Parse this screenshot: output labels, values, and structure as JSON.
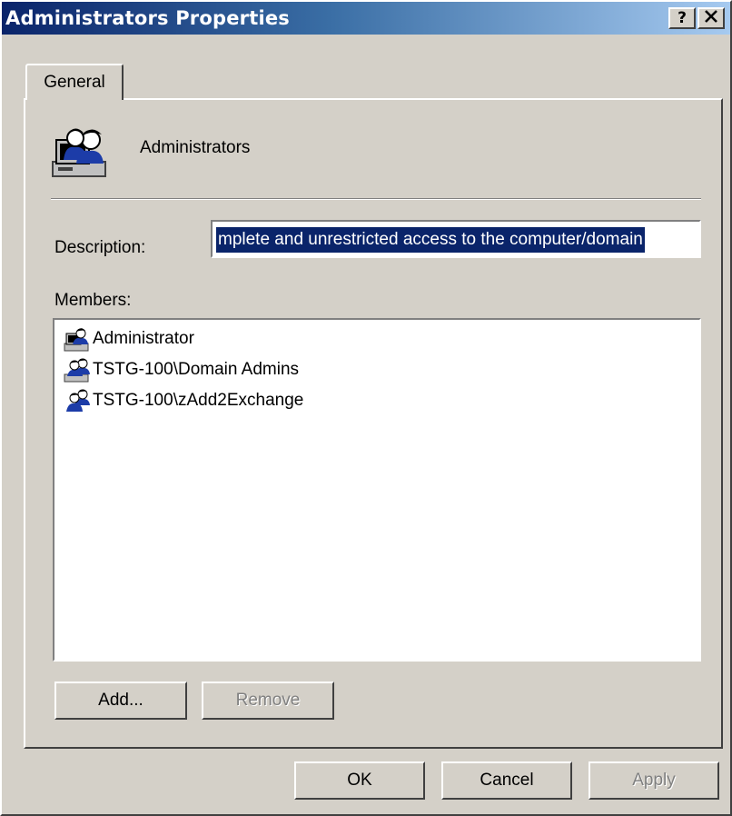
{
  "window": {
    "title": "Administrators Properties",
    "help_label": "?",
    "close_label": "✕"
  },
  "tabs": [
    {
      "label": "General"
    }
  ],
  "group": {
    "name": "Administrators",
    "icon": "group-icon"
  },
  "description": {
    "label": "Description:",
    "value": "mplete and unrestricted access to the computer/domain"
  },
  "members": {
    "label": "Members:",
    "items": [
      {
        "name": "Administrator",
        "icon": "user-icon"
      },
      {
        "name": "TSTG-100\\Domain Admins",
        "icon": "group-icon"
      },
      {
        "name": "TSTG-100\\zAdd2Exchange",
        "icon": "group-icon"
      }
    ]
  },
  "buttons": {
    "add": "Add...",
    "remove": "Remove",
    "ok": "OK",
    "cancel": "Cancel",
    "apply": "Apply"
  },
  "colors": {
    "title_active": "#0a246a",
    "title_gradient_end": "#a6caf0",
    "face": "#d4d0c8",
    "selection": "#0a246a"
  }
}
